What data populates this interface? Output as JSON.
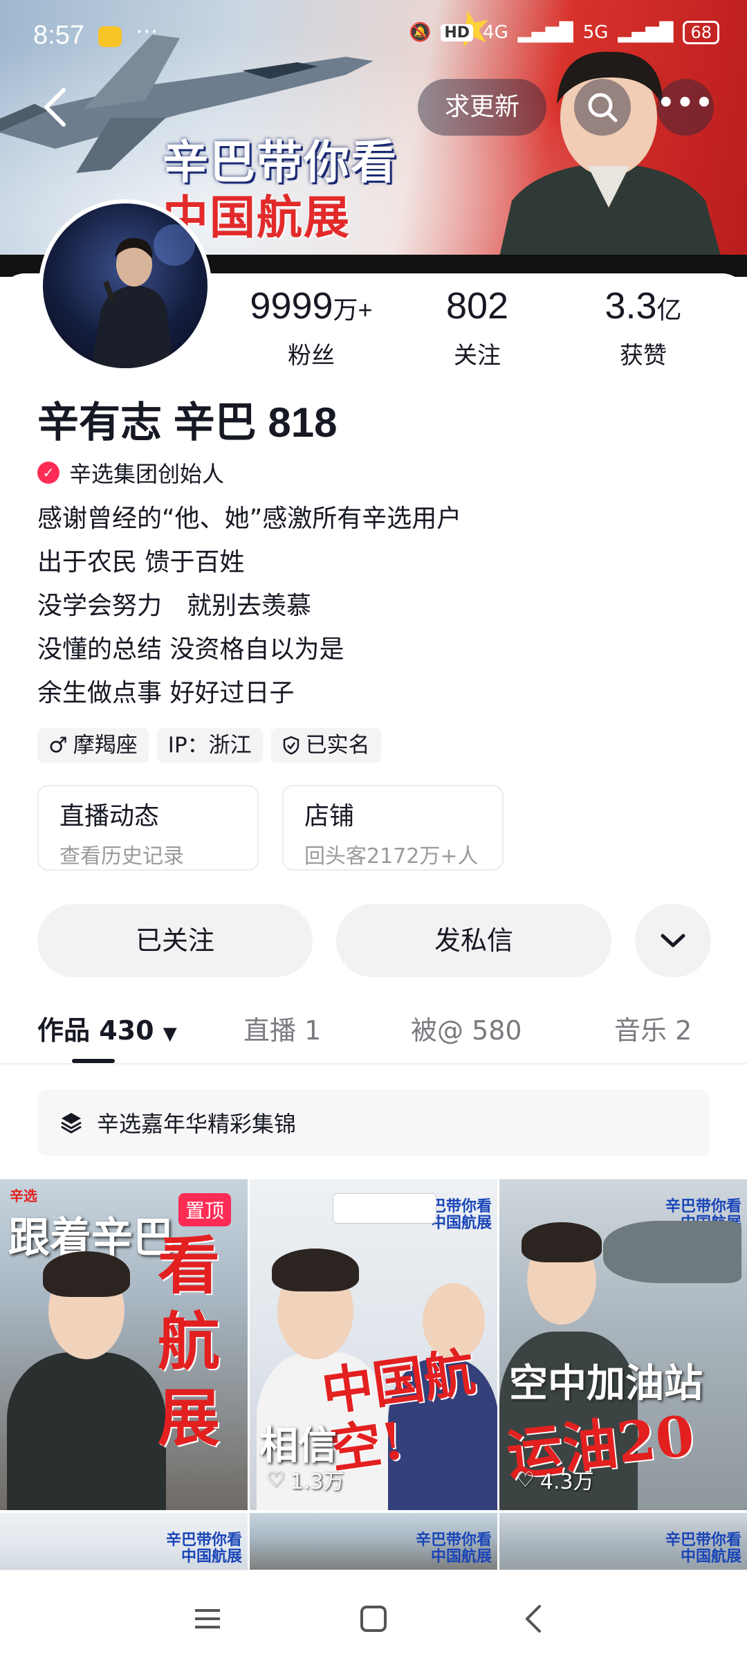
{
  "status_bar": {
    "time": "8:57",
    "network_1": "4G",
    "network_2": "5G",
    "hd": "HD",
    "battery": "68"
  },
  "banner": {
    "line1": "辛巴带你看",
    "line2": "中国航展"
  },
  "top_actions": {
    "request_update": "求更新"
  },
  "stats": [
    {
      "num": "9999",
      "unit": "万+",
      "label": "粉丝"
    },
    {
      "num": "802",
      "unit": "",
      "label": "关注"
    },
    {
      "num": "3.3",
      "unit": "亿",
      "label": "获赞"
    }
  ],
  "profile": {
    "name": "辛有志 辛巴 818",
    "verification": "辛选集团创始人",
    "bio": [
      "感谢曾经的“他、她”感激所有辛选用户",
      "出于农民 馈于百姓",
      "没学会努力　就别去羡慕",
      "没懂的总结  没资格自以为是",
      "余生做点事 好好过日子"
    ],
    "tags": [
      "摩羯座",
      "IP：浙江",
      "已实名"
    ]
  },
  "info_cards": [
    {
      "title": "直播动态",
      "subtitle": "查看历史记录"
    },
    {
      "title": "店铺",
      "subtitle": "回头客2172万+人"
    }
  ],
  "buttons": {
    "followed": "已关注",
    "message": "发私信"
  },
  "tabs": [
    {
      "label": "作品 430"
    },
    {
      "label": "直播 1"
    },
    {
      "label": "被@ 580"
    },
    {
      "label": "音乐 2"
    }
  ],
  "collection": {
    "label": "辛选嘉年华精彩集锦"
  },
  "videos": [
    {
      "overlay_top": "跟着辛巴",
      "overlay_main": "看航展",
      "pinned": "置顶",
      "likes": "",
      "brand": "辛选"
    },
    {
      "overlay_top": "相信",
      "overlay_main": "中国航空!",
      "pinned": "",
      "likes": "1.3万",
      "brand": "辛巴带你看\n中国航展"
    },
    {
      "overlay_top": "空中加油站",
      "overlay_main": "运油20",
      "pinned": "",
      "likes": "4.3万",
      "brand": "辛巴带你看\n中国航展"
    }
  ],
  "row2_brand": "辛巴带你看\n中国航展"
}
